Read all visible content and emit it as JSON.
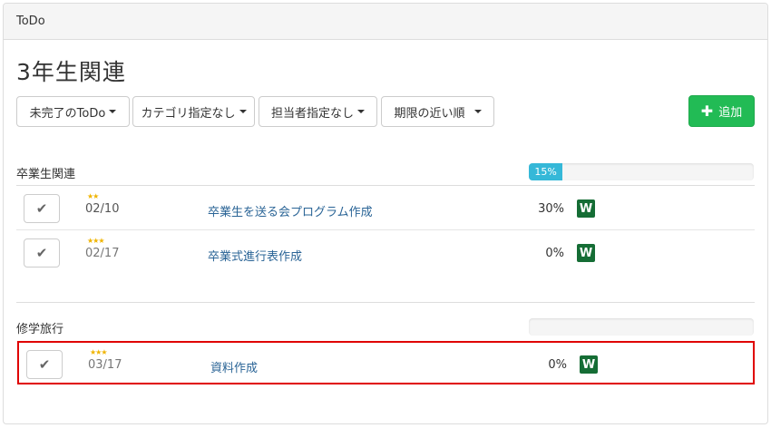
{
  "panel": {
    "title": "ToDo"
  },
  "page_title": "3年生関連",
  "filters": {
    "status": "未完了のToDo",
    "category": "カテゴリ指定なし",
    "assignee": "担当者指定なし",
    "sort": "期限の近い順"
  },
  "add_button": {
    "label": "追加"
  },
  "groups": [
    {
      "title": "卒業生関連",
      "progress": 15,
      "progress_label": "15%",
      "tasks": [
        {
          "stars": "★★",
          "due": "02/10",
          "name": "卒業生を送る会プログラム作成",
          "percent": "30%",
          "badge": "W"
        },
        {
          "stars": "★★★",
          "due": "02/17",
          "name": "卒業式進行表作成",
          "percent": "0%",
          "badge": "W"
        }
      ]
    },
    {
      "title": "修学旅行",
      "progress": 0,
      "progress_label": "",
      "tasks": [
        {
          "stars": "★★★",
          "due": "03/17",
          "name": "資料作成",
          "percent": "0%",
          "badge": "W"
        }
      ]
    }
  ],
  "colors": {
    "progress": "#35b8d8",
    "add": "#22bb55",
    "badge": "#156d35",
    "selection": "#e00000",
    "link": "#2a6496"
  }
}
